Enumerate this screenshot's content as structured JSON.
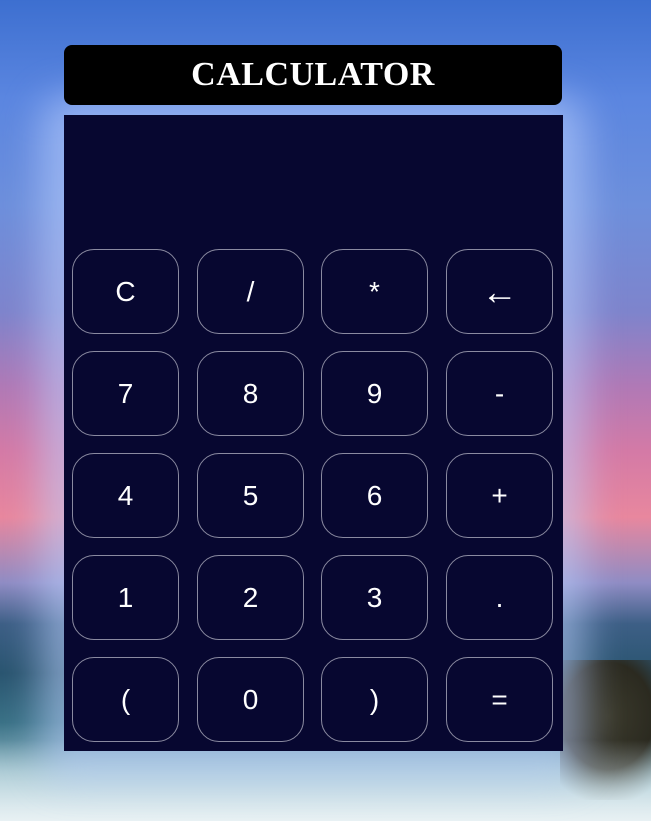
{
  "title": "CALCULATOR",
  "display": {
    "value": ""
  },
  "keys": {
    "clear": "C",
    "divide": "/",
    "multiply": "*",
    "backspace": "←",
    "seven": "7",
    "eight": "8",
    "nine": "9",
    "minus": "-",
    "four": "4",
    "five": "5",
    "six": "6",
    "plus": "+",
    "one": "1",
    "two": "2",
    "three": "3",
    "decimal": ".",
    "open_paren": "(",
    "zero": "0",
    "close_paren": ")",
    "equals": "="
  },
  "colors": {
    "title_bar": "#000000",
    "calculator_body": "#070730",
    "key_border": "#8a8aa0",
    "text": "#ffffff"
  }
}
